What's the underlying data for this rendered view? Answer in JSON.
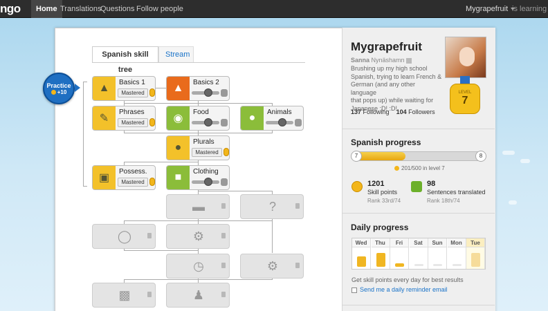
{
  "topbar": {
    "logo": "ngo",
    "nav": [
      "Home",
      "Translations",
      "Questions",
      "Follow people"
    ],
    "user": "Mygrapefruit",
    "learning": "is learning"
  },
  "tabs": {
    "active": "Spanish skill tree",
    "link": "Stream"
  },
  "practice": {
    "label": "Practice",
    "bonus": "+10"
  },
  "skills": {
    "basics1": {
      "name": "Basics 1",
      "status": "Mastered"
    },
    "basics2": {
      "name": "Basics 2"
    },
    "phrases": {
      "name": "Phrases",
      "status": "Mastered"
    },
    "food": {
      "name": "Food"
    },
    "animals": {
      "name": "Animals"
    },
    "plurals": {
      "name": "Plurals",
      "status": "Mastered"
    },
    "possess": {
      "name": "Possess.",
      "status": "Mastered"
    },
    "clothing": {
      "name": "Clothing"
    }
  },
  "profile": {
    "name": "Mygrapefruit",
    "first": "Sanna",
    "last": "Nynäshamn",
    "bio": [
      "Brushing up my high school",
      "Spanish, trying to learn French &",
      "German (and any other language",
      "that pops up) while waiting for",
      "Japanese :D! :D!"
    ],
    "following_count": "137",
    "following_label": "Following",
    "followers_count": "104",
    "followers_label": "Followers",
    "level_label": "LEVEL",
    "level": "7"
  },
  "spanish_progress": {
    "title": "Spanish progress",
    "current_level": "7",
    "next_level": "8",
    "fraction": 0.4,
    "points_text": "201/500 in level 7",
    "skill_points": "1201",
    "skill_points_label": "Skill points",
    "skill_rank": "Rank 33rd/74",
    "sentences": "98",
    "sentences_label": "Sentences translated",
    "sentences_rank": "Rank 18th/74"
  },
  "daily_progress": {
    "title": "Daily progress",
    "days": [
      {
        "d": "Wed",
        "stack": 3
      },
      {
        "d": "Thu",
        "stack": 4
      },
      {
        "d": "Fri",
        "stack": 1
      },
      {
        "d": "Sat",
        "stack": 0
      },
      {
        "d": "Sun",
        "stack": 0
      },
      {
        "d": "Mon",
        "stack": 0
      },
      {
        "d": "Tue",
        "stack": 4,
        "today": true
      }
    ],
    "hint": "Get skill points every day for best results",
    "reminder": "Send me a daily reminder email"
  },
  "colors": {
    "accent": "#1f6fc2",
    "gold": "#f3c12a",
    "green": "#8bbd3a",
    "orange": "#e96b1c"
  }
}
